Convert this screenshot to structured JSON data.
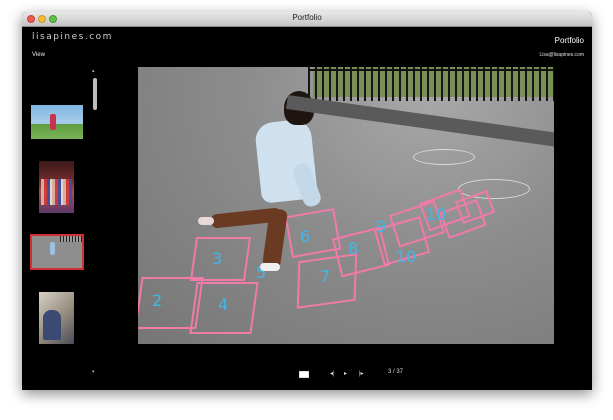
{
  "window": {
    "title": "Portfolio"
  },
  "header": {
    "logo": "lisapines.com",
    "menu_view": "View",
    "site_title": "Portfolio",
    "site_email": "Lisa@lisapines.com"
  },
  "sidebar": {
    "scroll_up_glyph": "▴",
    "scroll_down_glyph": "▾",
    "thumbnails": [
      {
        "subject": "girl-on-grass"
      },
      {
        "subject": "group-of-children"
      },
      {
        "subject": "hopscotch",
        "selected": true
      },
      {
        "subject": "reader-on-bench"
      }
    ]
  },
  "main_photo": {
    "subject": "girl-playing-hopscotch",
    "chalk_numbers": [
      "2",
      "4",
      "3",
      "5",
      "7",
      "6",
      "8",
      "9",
      "10",
      "10"
    ]
  },
  "controls": {
    "prev_glyph": "◂|",
    "play_glyph": "▸",
    "next_glyph": "|▸",
    "counter": "3 / 37"
  },
  "colors": {
    "background": "#000000",
    "chalk_pink": "#f07aa8",
    "chalk_blue": "#3fb8e8",
    "selection": "#d03030"
  }
}
